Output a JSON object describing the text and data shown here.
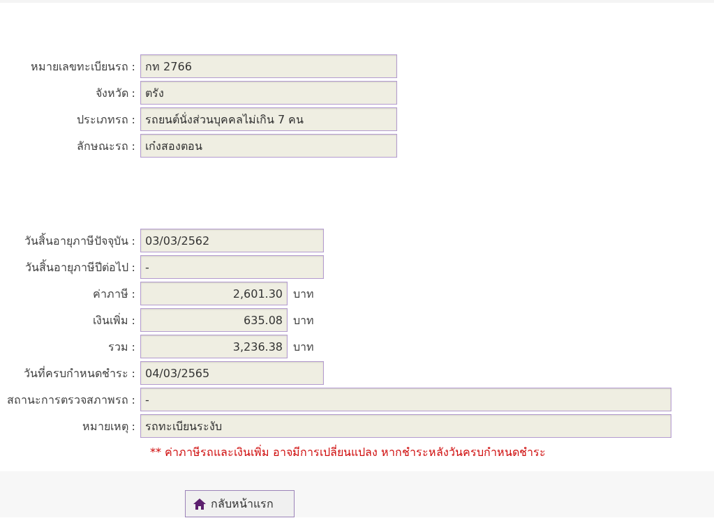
{
  "sections": [
    {
      "fields": [
        {
          "label": "หมายเลขทะเบียนรถ :",
          "value": "กท 2766",
          "kind": "medium"
        },
        {
          "label": "จังหวัด :",
          "value": "ตรัง",
          "kind": "medium"
        },
        {
          "label": "ประเภทรถ :",
          "value": "รถยนต์นั่งส่วนบุคคลไม่เกิน 7 คน",
          "kind": "medium"
        },
        {
          "label": "ลักษณะรถ :",
          "value": "เก๋งสองตอน",
          "kind": "medium"
        }
      ]
    },
    {
      "fields": [
        {
          "label": "วันสิ้นอายุภาษีปัจจุบัน :",
          "value": "03/03/2562",
          "kind": "short"
        },
        {
          "label": "วันสิ้นอายุภาษีปีต่อไป :",
          "value": "-",
          "kind": "short"
        },
        {
          "label": "ค่าภาษี :",
          "value": "2,601.30",
          "kind": "amount",
          "unit": "บาท"
        },
        {
          "label": "เงินเพิ่ม :",
          "value": "635.08",
          "kind": "amount",
          "unit": "บาท"
        },
        {
          "label": "รวม :",
          "value": "3,236.38",
          "kind": "amount",
          "unit": "บาท"
        },
        {
          "label": "วันที่ครบกำหนดชำระ :",
          "value": "04/03/2565",
          "kind": "short"
        },
        {
          "label": "สถานะการตรวจสภาพรถ :",
          "value": "-",
          "kind": "long"
        },
        {
          "label": "หมายเหตุ :",
          "value": "รถทะเบียนระงับ",
          "kind": "long"
        }
      ]
    }
  ],
  "note": "** ค่าภาษีรถและเงินเพิ่ม อาจมีการเปลี่ยนแปลง หากชำระหลังวันครบกำหนดชำระ",
  "home_button": "กลับหน้าแรก"
}
